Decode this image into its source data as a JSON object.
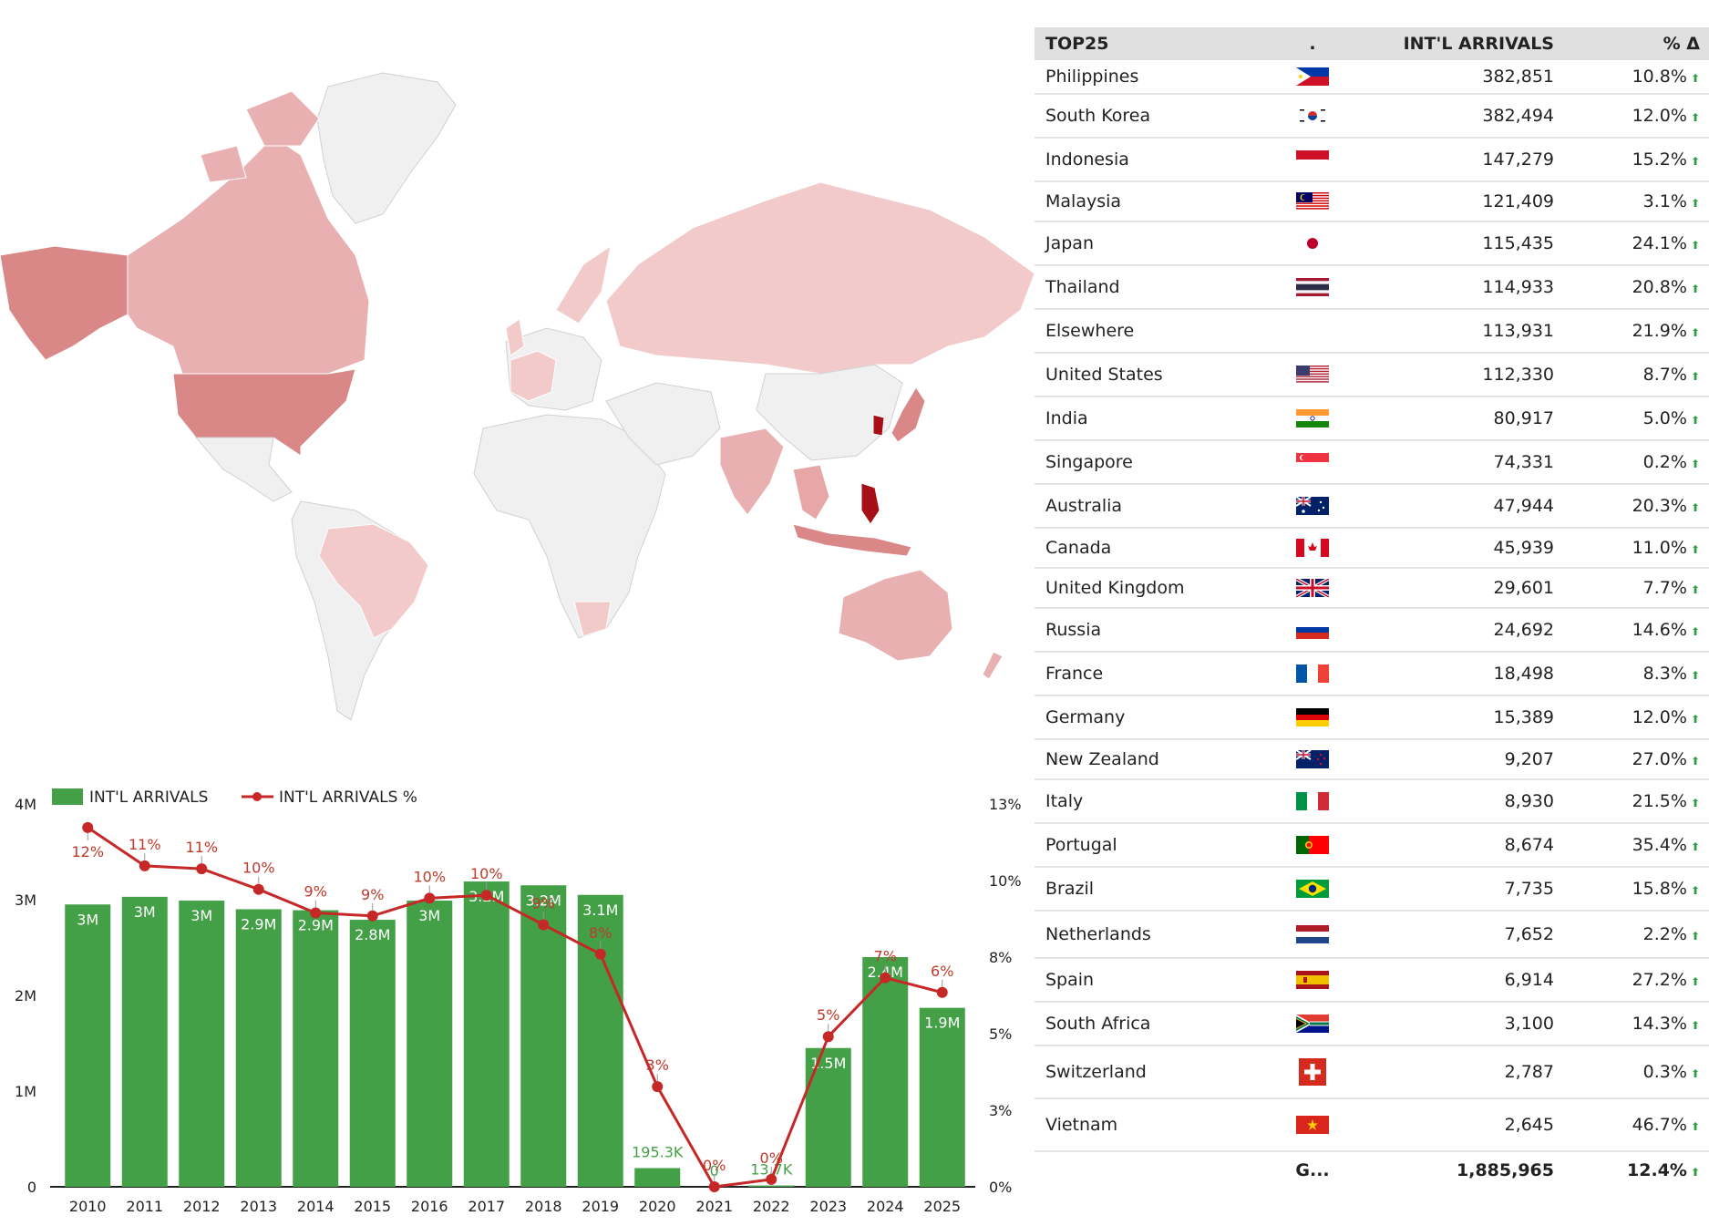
{
  "colors": {
    "bar": "#43a047",
    "line": "#c62828",
    "map_empty": "#f0f0f0",
    "map_low": "#f3caca",
    "map_mid": "#e8a7a7",
    "map_high": "#d98787",
    "map_top": "#a50f15",
    "header_bg": "#e0e0e0",
    "up_arrow": "#2e9e44"
  },
  "table": {
    "headers": [
      "TOP25",
      ".",
      "INT'L ARRIVALS",
      "% Δ"
    ],
    "rows": [
      {
        "country": "Philippines",
        "flag": "philippines-flag-icon",
        "arrivals": "382,851",
        "pct": "10.8%"
      },
      {
        "country": "South Korea",
        "flag": "south-korea-flag-icon",
        "arrivals": "382,494",
        "pct": "12.0%"
      },
      {
        "country": "Indonesia",
        "flag": "indonesia-flag-icon",
        "arrivals": "147,279",
        "pct": "15.2%"
      },
      {
        "country": "Malaysia",
        "flag": "malaysia-flag-icon",
        "arrivals": "121,409",
        "pct": "3.1%"
      },
      {
        "country": "Japan",
        "flag": "japan-flag-icon",
        "arrivals": "115,435",
        "pct": "24.1%"
      },
      {
        "country": "Thailand",
        "flag": "thailand-flag-icon",
        "arrivals": "114,933",
        "pct": "20.8%"
      },
      {
        "country": "Elsewhere",
        "flag": "",
        "arrivals": "113,931",
        "pct": "21.9%"
      },
      {
        "country": "United States",
        "flag": "united-states-flag-icon",
        "arrivals": "112,330",
        "pct": "8.7%"
      },
      {
        "country": "India",
        "flag": "india-flag-icon",
        "arrivals": "80,917",
        "pct": "5.0%"
      },
      {
        "country": "Singapore",
        "flag": "singapore-flag-icon",
        "arrivals": "74,331",
        "pct": "0.2%"
      },
      {
        "country": "Australia",
        "flag": "australia-flag-icon",
        "arrivals": "47,944",
        "pct": "20.3%"
      },
      {
        "country": "Canada",
        "flag": "canada-flag-icon",
        "arrivals": "45,939",
        "pct": "11.0%"
      },
      {
        "country": "United Kingdom",
        "flag": "united-kingdom-flag-icon",
        "arrivals": "29,601",
        "pct": "7.7%"
      },
      {
        "country": "Russia",
        "flag": "russia-flag-icon",
        "arrivals": "24,692",
        "pct": "14.6%"
      },
      {
        "country": "France",
        "flag": "france-flag-icon",
        "arrivals": "18,498",
        "pct": "8.3%"
      },
      {
        "country": "Germany",
        "flag": "germany-flag-icon",
        "arrivals": "15,389",
        "pct": "12.0%"
      },
      {
        "country": "New Zealand",
        "flag": "new-zealand-flag-icon",
        "arrivals": "9,207",
        "pct": "27.0%"
      },
      {
        "country": "Italy",
        "flag": "italy-flag-icon",
        "arrivals": "8,930",
        "pct": "21.5%"
      },
      {
        "country": "Portugal",
        "flag": "portugal-flag-icon",
        "arrivals": "8,674",
        "pct": "35.4%"
      },
      {
        "country": "Brazil",
        "flag": "brazil-flag-icon",
        "arrivals": "7,735",
        "pct": "15.8%"
      },
      {
        "country": "Netherlands",
        "flag": "netherlands-flag-icon",
        "arrivals": "7,652",
        "pct": "2.2%"
      },
      {
        "country": "Spain",
        "flag": "spain-flag-icon",
        "arrivals": "6,914",
        "pct": "27.2%"
      },
      {
        "country": "South Africa",
        "flag": "south-africa-flag-icon",
        "arrivals": "3,100",
        "pct": "14.3%"
      },
      {
        "country": "Switzerland",
        "flag": "switzerland-flag-icon",
        "arrivals": "2,787",
        "pct": "0.3%"
      },
      {
        "country": "Vietnam",
        "flag": "vietnam-flag-icon",
        "arrivals": "2,645",
        "pct": "46.7%"
      }
    ],
    "footer": {
      "label": "G...",
      "arrivals": "1,885,965",
      "pct": "12.4%"
    },
    "up_glyph": "⬆"
  },
  "chart_data": {
    "type": "bar",
    "categories": [
      "2010",
      "2011",
      "2012",
      "2013",
      "2014",
      "2015",
      "2016",
      "2017",
      "2018",
      "2019",
      "2020",
      "2021",
      "2022",
      "2023",
      "2024",
      "2025"
    ],
    "series": [
      {
        "name": "INT'L ARRIVALS",
        "kind": "bar",
        "axis": "left",
        "values": [
          2950000,
          3030000,
          2990000,
          2900000,
          2890000,
          2790000,
          2990000,
          3190000,
          3150000,
          3050000,
          195300,
          0,
          13700,
          1450000,
          2400000,
          1870000
        ],
        "labels": [
          "3M",
          "3M",
          "3M",
          "2.9M",
          "2.9M",
          "2.8M",
          "3M",
          "3.2M",
          "3.2M",
          "3.1M",
          "195.3K",
          "0",
          "13.7K",
          "1.5M",
          "2.4M",
          "1.9M"
        ]
      },
      {
        "name": "INT'L ARRIVALS %",
        "kind": "line",
        "axis": "right",
        "values": [
          12.2,
          10.9,
          10.8,
          10.1,
          9.3,
          9.2,
          9.8,
          9.9,
          8.9,
          7.9,
          3.4,
          0,
          0.25,
          5.1,
          7.1,
          6.6
        ],
        "labels": [
          "12%",
          "11%",
          "11%",
          "10%",
          "9%",
          "9%",
          "10%",
          "10%",
          "9%",
          "8%",
          "3%",
          "0%",
          "0%",
          "5%",
          "7%",
          "6%"
        ]
      }
    ],
    "y_left": {
      "min": 0,
      "max": 4000000,
      "ticks": [
        0,
        1000000,
        2000000,
        3000000,
        4000000
      ],
      "tick_labels": [
        "0",
        "1M",
        "2M",
        "3M",
        "4M"
      ]
    },
    "y_right": {
      "min": 0,
      "max": 13,
      "ticks": [
        0,
        2.6,
        5.2,
        7.8,
        10.4,
        13
      ],
      "tick_labels": [
        "0%",
        "3%",
        "5%",
        "8%",
        "10%",
        "13%"
      ]
    },
    "legend_position": "top-left",
    "grid": false
  }
}
